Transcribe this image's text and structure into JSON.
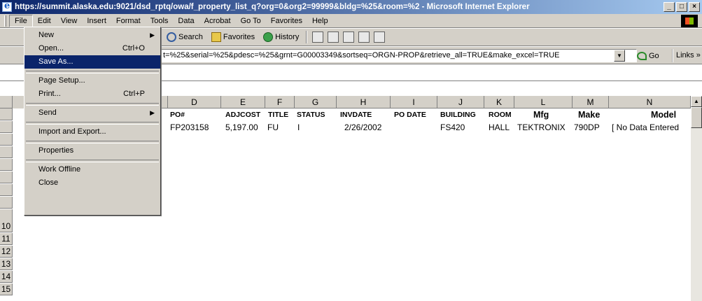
{
  "window": {
    "title": "https://summit.alaska.edu:9021/dsd_rptq/owa/f_property_list_q?org=0&org2=99999&bldg=%25&room=%2 - Microsoft Internet Explorer",
    "min": "_",
    "max": "□",
    "close": "×"
  },
  "menubar": {
    "items": [
      "File",
      "Edit",
      "View",
      "Insert",
      "Format",
      "Tools",
      "Data",
      "Acrobat",
      "Go To",
      "Favorites",
      "Help"
    ]
  },
  "toolbar": {
    "search": "Search",
    "favorites": "Favorites",
    "history": "History"
  },
  "address": {
    "value": "t=%25&serial=%25&pdesc=%25&grnt=G00003349&sortseq=ORGN-PROP&retrieve_all=TRUE&make_excel=TRUE",
    "go": "Go",
    "links": "Links »"
  },
  "file_menu": {
    "items": [
      {
        "label": "New",
        "shortcut": "",
        "submenu": true
      },
      {
        "label": "Open...",
        "shortcut": "Ctrl+O",
        "submenu": false
      },
      {
        "label": "Save As...",
        "shortcut": "",
        "submenu": false,
        "selected": true
      },
      {
        "sep": true
      },
      {
        "label": "Page Setup...",
        "shortcut": "",
        "submenu": false
      },
      {
        "label": "Print...",
        "shortcut": "Ctrl+P",
        "submenu": false
      },
      {
        "sep": true
      },
      {
        "label": "Send",
        "shortcut": "",
        "submenu": true
      },
      {
        "sep": true
      },
      {
        "label": "Import and Export...",
        "shortcut": "",
        "submenu": false
      },
      {
        "sep": true
      },
      {
        "label": "Properties",
        "shortcut": "",
        "submenu": false
      },
      {
        "sep": true
      },
      {
        "label": "Work Offline",
        "shortcut": "",
        "submenu": false
      },
      {
        "label": "Close",
        "shortcut": "",
        "submenu": false
      }
    ]
  },
  "sheet": {
    "columns": [
      "D",
      "E",
      "F",
      "G",
      "H",
      "I",
      "J",
      "K",
      "L",
      "M",
      "N"
    ],
    "headers": [
      "PO#",
      "ADJCOST",
      "TITLE",
      "STATUS",
      "INVDATE",
      "PO DATE",
      "BUILDING",
      "ROOM",
      "Mfg",
      "Make",
      "Model"
    ],
    "row2": [
      "FP203158",
      "5,197.00",
      "FU",
      "I",
      "2/26/2002",
      "",
      "FS420",
      "HALL",
      "TEKTRONIX",
      "790DP",
      "[ No Data Entered"
    ],
    "row_numbers": [
      "10",
      "11",
      "12",
      "13",
      "14",
      "15"
    ]
  }
}
